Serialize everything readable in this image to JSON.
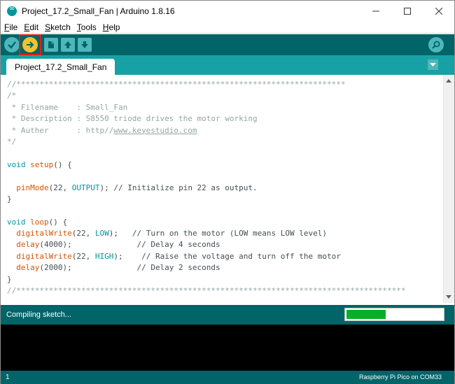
{
  "window": {
    "title": "Project_17.2_Small_Fan | Arduino 1.8.16",
    "minimize_icon": "minimize-icon",
    "maximize_icon": "maximize-icon",
    "close_icon": "close-icon"
  },
  "menu": {
    "items": [
      {
        "label": "File",
        "underline": "F",
        "rest": "ile"
      },
      {
        "label": "Edit",
        "underline": "E",
        "rest": "dit"
      },
      {
        "label": "Sketch",
        "underline": "S",
        "rest": "ketch"
      },
      {
        "label": "Tools",
        "underline": "T",
        "rest": "ools"
      },
      {
        "label": "Help",
        "underline": "H",
        "rest": "elp"
      }
    ]
  },
  "toolbar": {
    "verify_icon": "checkmark-icon",
    "upload_icon": "arrow-right-icon",
    "new_icon": "new-file-icon",
    "open_icon": "arrow-up-icon",
    "save_icon": "arrow-down-icon",
    "serial_monitor_icon": "magnifier-icon"
  },
  "tabs": {
    "active": "Project_17.2_Small_Fan",
    "menu_icon": "triangle-down-icon"
  },
  "code": {
    "lines": [
      [
        {
          "t": "//***********************************************************************",
          "c": "c-comment"
        }
      ],
      [
        {
          "t": "/*",
          "c": "c-comment"
        }
      ],
      [
        {
          "t": " * Filename    : Small_Fan",
          "c": "c-comment"
        }
      ],
      [
        {
          "t": " * Description : S8550 triode drives the motor working",
          "c": "c-comment"
        }
      ],
      [
        {
          "t": " * Auther      : http//",
          "c": "c-comment"
        },
        {
          "t": "www.keyestudio.com",
          "c": "c-link"
        }
      ],
      [
        {
          "t": "*/",
          "c": "c-comment"
        }
      ],
      [],
      [
        {
          "t": "void",
          "c": "c-keyword"
        },
        {
          "t": " ",
          "c": "c-plain"
        },
        {
          "t": "setup",
          "c": "c-func"
        },
        {
          "t": "() {",
          "c": "c-plain"
        }
      ],
      [],
      [
        {
          "t": "  ",
          "c": "c-plain"
        },
        {
          "t": "pinMode",
          "c": "c-func"
        },
        {
          "t": "(22, ",
          "c": "c-plain"
        },
        {
          "t": "OUTPUT",
          "c": "c-const"
        },
        {
          "t": "); // Initialize pin 22 as output.",
          "c": "c-plain"
        }
      ],
      [
        {
          "t": "}",
          "c": "c-plain"
        }
      ],
      [],
      [
        {
          "t": "void",
          "c": "c-keyword"
        },
        {
          "t": " ",
          "c": "c-plain"
        },
        {
          "t": "loop",
          "c": "c-func"
        },
        {
          "t": "() {",
          "c": "c-plain"
        }
      ],
      [
        {
          "t": "  ",
          "c": "c-plain"
        },
        {
          "t": "digitalWrite",
          "c": "c-func"
        },
        {
          "t": "(22, ",
          "c": "c-plain"
        },
        {
          "t": "LOW",
          "c": "c-const"
        },
        {
          "t": ");   // Turn on the motor (LOW means LOW level)",
          "c": "c-plain"
        }
      ],
      [
        {
          "t": "  ",
          "c": "c-plain"
        },
        {
          "t": "delay",
          "c": "c-func"
        },
        {
          "t": "(4000);              // Delay 4 seconds",
          "c": "c-plain"
        }
      ],
      [
        {
          "t": "  ",
          "c": "c-plain"
        },
        {
          "t": "digitalWrite",
          "c": "c-func"
        },
        {
          "t": "(22, ",
          "c": "c-plain"
        },
        {
          "t": "HIGH",
          "c": "c-const"
        },
        {
          "t": ");    // Raise the voltage and turn off the motor",
          "c": "c-plain"
        }
      ],
      [
        {
          "t": "  ",
          "c": "c-plain"
        },
        {
          "t": "delay",
          "c": "c-func"
        },
        {
          "t": "(2000);              // Delay 2 seconds",
          "c": "c-plain"
        }
      ],
      [
        {
          "t": "}",
          "c": "c-plain"
        }
      ],
      [
        {
          "t": "//************************************************************************************",
          "c": "c-comment"
        }
      ]
    ]
  },
  "status": {
    "text": "Compiling sketch...",
    "progress_fraction": 0.41
  },
  "bottom": {
    "line_number": "1",
    "board": "Raspberry Pi Pico on COM33"
  },
  "colors": {
    "toolbar": "#006468",
    "tabbar": "#17a1a5",
    "highlight": "#e02020",
    "progress": "#06b025"
  }
}
